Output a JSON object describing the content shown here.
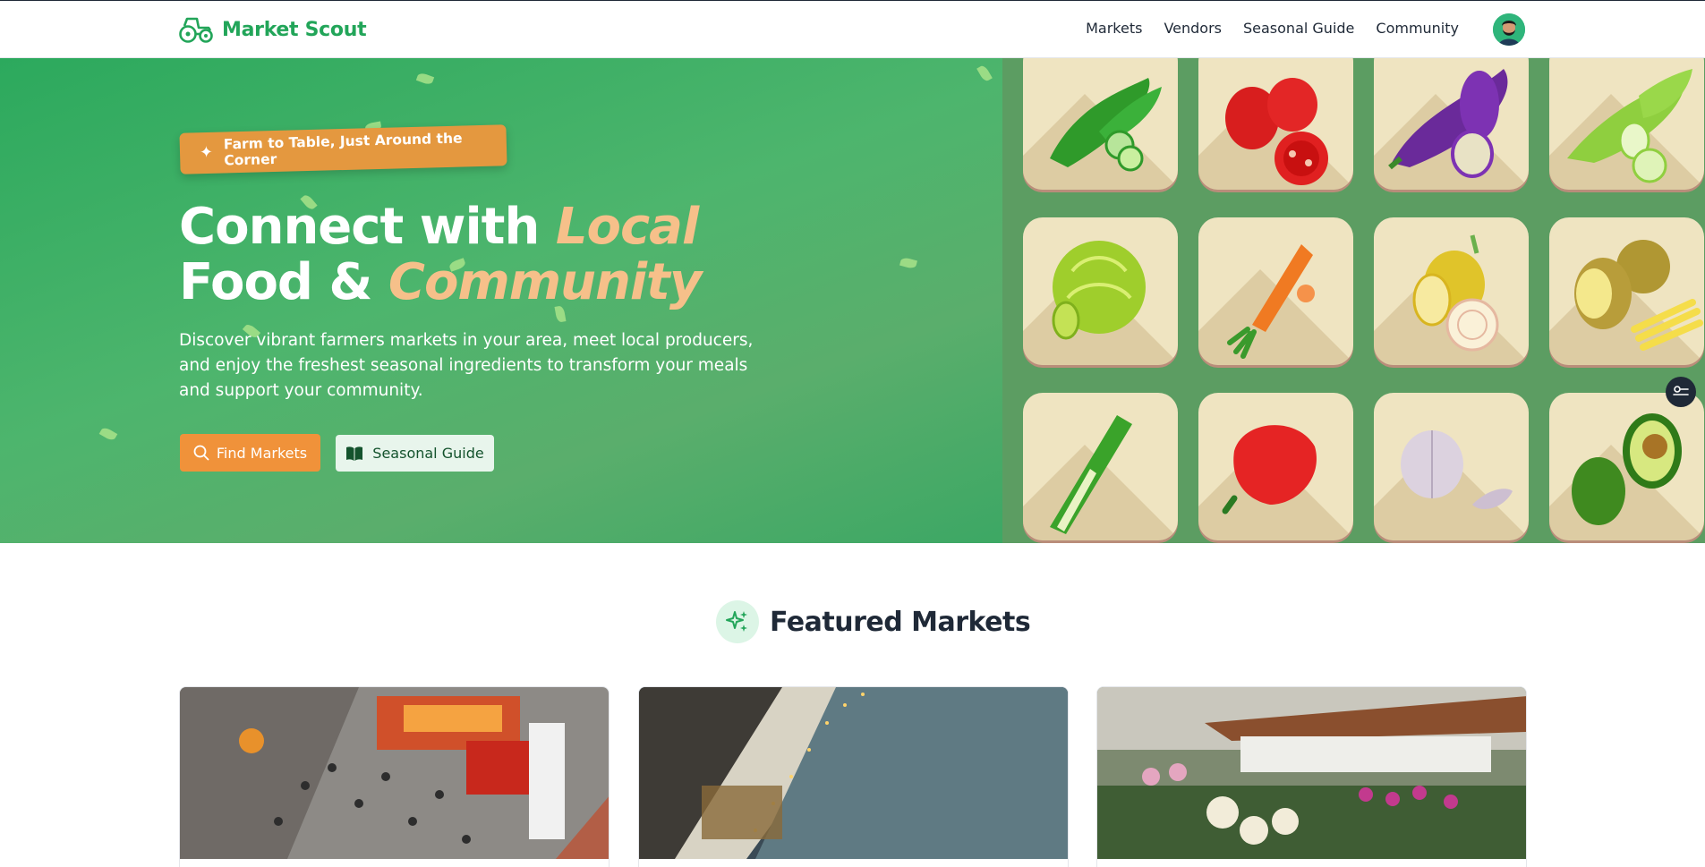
{
  "app": {
    "name": "Market Scout",
    "logo_icon": "tractor-icon",
    "accent_color": "#22a559"
  },
  "nav": {
    "items": [
      "Markets",
      "Vendors",
      "Seasonal Guide",
      "Community"
    ],
    "avatar_icon": "user-avatar-icon"
  },
  "hero": {
    "badge_icon": "sparkle-icon",
    "badge_text": "Farm to Table, Just Around the Corner",
    "title_line1_plain": "Connect with ",
    "title_line1_accent": "Local",
    "title_line2_plain": "Food & ",
    "title_line2_accent": "Community",
    "description": "Discover vibrant farmers markets in your area, meet local producers, and enjoy the freshest seasonal ingredients to transform your meals and support your community.",
    "primary_button": {
      "label": "Find Markets",
      "icon": "search-icon",
      "color": "#f0923a"
    },
    "secondary_button": {
      "label": "Seasonal Guide",
      "icon": "book-icon"
    },
    "vegetables": [
      "cucumber",
      "tomato",
      "eggplant",
      "zucchini",
      "cabbage",
      "carrot",
      "onion",
      "potato",
      "leek",
      "bell-pepper",
      "garlic",
      "avocado"
    ]
  },
  "featured": {
    "icon": "sparkles-icon",
    "title": "Featured Markets",
    "cards": [
      {
        "image": "busy-street-market-photo"
      },
      {
        "image": "riverside-night-market-photo"
      },
      {
        "image": "flower-market-stall-photo"
      }
    ]
  },
  "widgets": {
    "side_toggle_icon": "settings-toggle-icon"
  }
}
